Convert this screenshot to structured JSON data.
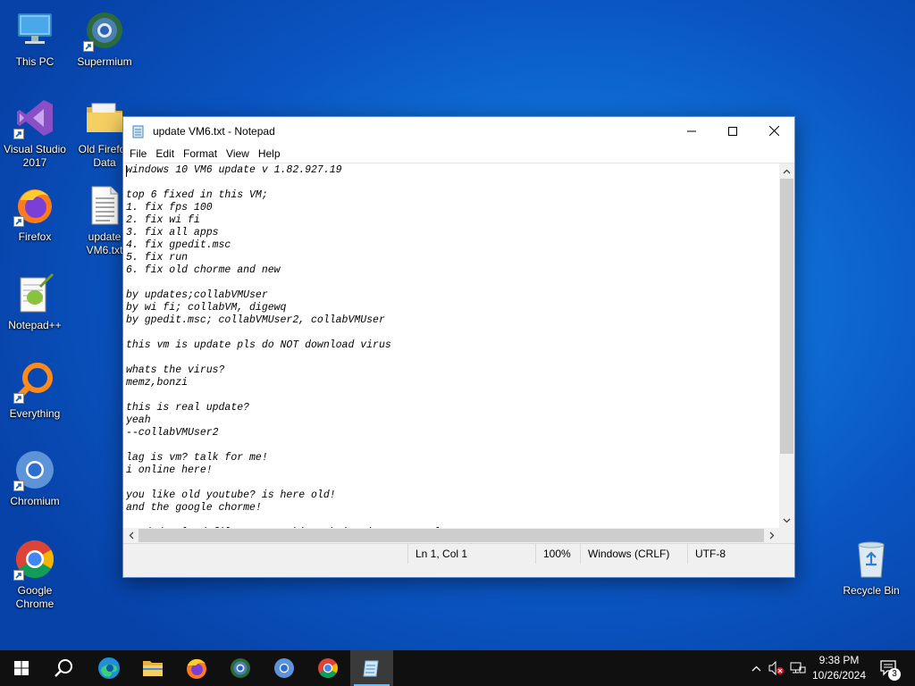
{
  "desktop": {
    "icons": [
      {
        "id": "this-pc",
        "label": "This PC"
      },
      {
        "id": "supermium",
        "label": "Supermium"
      },
      {
        "id": "visual-studio",
        "label": "Visual Studio\n2017"
      },
      {
        "id": "old-firefox-data",
        "label": "Old Firefox\nData"
      },
      {
        "id": "firefox",
        "label": "Firefox"
      },
      {
        "id": "update-file",
        "label": "update\nVM6.txt"
      },
      {
        "id": "notepadpp",
        "label": "Notepad++"
      },
      {
        "id": "everything",
        "label": "Everything"
      },
      {
        "id": "chromium",
        "label": "Chromium"
      },
      {
        "id": "google-chrome",
        "label": "Google\nChrome"
      },
      {
        "id": "recycle-bin",
        "label": "Recycle Bin"
      }
    ]
  },
  "notepad": {
    "title": "update VM6.txt - Notepad",
    "menu": [
      "File",
      "Edit",
      "Format",
      "View",
      "Help"
    ],
    "content": "windows 10 VM6 update v 1.82.927.19\n\ntop 6 fixed in this VM;\n1. fix fps 100\n2. fix wi fi\n3. fix all apps\n4. fix gpedit.msc\n5. fix run\n6. fix old chorme and new\n\nby updates;collabVMUser\nby wi fi; collabVM, digewq\nby gpedit.msc; collabVMUser2, collabVMUser\n\nthis vm is update pls do NOT download virus\n\nwhats the virus?\nmemz,bonzi\n\nthis is real update?\nyeah\n--collabVMUser2\n\nlag is vm? talk for me!\ni online here!\n\nyou like old youtube? is here old!\nand the google chorme!\n\nneed download files? open this website in your real pc!\ndpo.ma",
    "status": {
      "position": "Ln 1, Col 1",
      "zoom": "100%",
      "line_ending": "Windows (CRLF)",
      "encoding": "UTF-8"
    }
  },
  "taskbar": {
    "apps": [
      "start",
      "search",
      "edge",
      "file-explorer",
      "firefox",
      "supermium",
      "chromium",
      "chrome",
      "notepad"
    ],
    "active": "notepad",
    "time": "9:38 PM",
    "date": "10/26/2024",
    "notification_count": "3"
  },
  "colors": {
    "desktop_blue": "#0a55c2",
    "taskbar": "#101010",
    "accent": "#76b9ed"
  }
}
